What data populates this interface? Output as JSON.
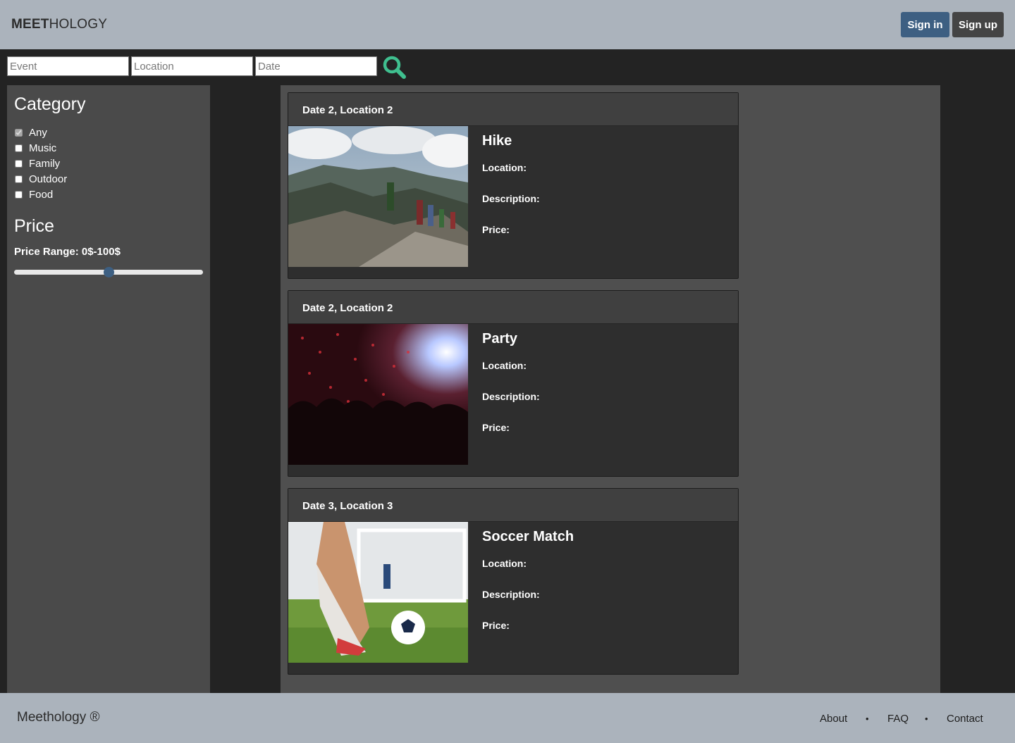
{
  "header": {
    "logo_bold": "MEET",
    "logo_rest": "HOLOGY",
    "signin_label": "Sign in",
    "signup_label": "Sign up"
  },
  "search": {
    "event_placeholder": "Event",
    "location_placeholder": "Location",
    "date_placeholder": "Date",
    "button_icon": "search-icon"
  },
  "sidebar": {
    "category_heading": "Category",
    "categories": [
      {
        "label": "Any",
        "checked": true
      },
      {
        "label": "Music",
        "checked": false
      },
      {
        "label": "Family",
        "checked": false
      },
      {
        "label": "Outdoor",
        "checked": false
      },
      {
        "label": "Food",
        "checked": false
      }
    ],
    "price_heading": "Price",
    "price_range": "Price Range: 0$-100$",
    "slider_value_fraction": 0.5
  },
  "events": [
    {
      "header": "Date 2, Location 2",
      "title": "Hike",
      "location_label": "Location:",
      "description_label": "Description:",
      "price_label": "Price:",
      "image": "hike-photo"
    },
    {
      "header": "Date 2, Location 2",
      "title": "Party",
      "location_label": "Location:",
      "description_label": "Description:",
      "price_label": "Price:",
      "image": "concert-photo"
    },
    {
      "header": "Date 3, Location 3",
      "title": "Soccer Match",
      "location_label": "Location:",
      "description_label": "Description:",
      "price_label": "Price:",
      "image": "soccer-photo"
    }
  ],
  "footer": {
    "copyright": "Meethology ®",
    "links": [
      "About",
      "FAQ",
      "Contact"
    ],
    "separator": "•"
  },
  "colors": {
    "header_bg": "#abb3bc",
    "signin_bg": "#3d5f82",
    "search_icon": "#3fbf8f"
  }
}
